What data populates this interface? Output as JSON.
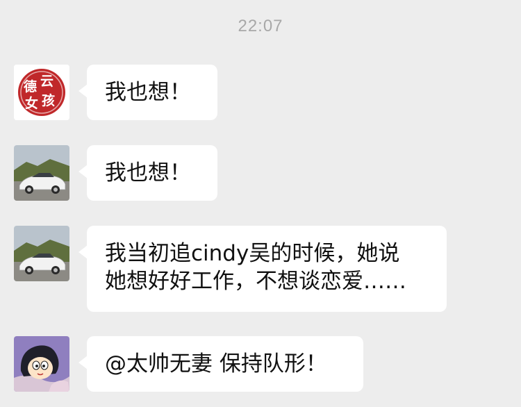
{
  "chat": {
    "timestamp": "22:07",
    "messages": [
      {
        "sender_avatar": "deyun-girl-stamp-avatar",
        "avatar_text": "德云女孩",
        "text": "我也想！"
      },
      {
        "sender_avatar": "white-sports-car-avatar",
        "text": "我也想！"
      },
      {
        "sender_avatar": "white-sports-car-avatar",
        "text": "我当初追cindy吴的时候，她说\n她想好好工作，不想谈恋爱……"
      },
      {
        "sender_avatar": "cartoon-girl-avatar",
        "text": "@太帅无妻  保持队形！"
      }
    ]
  },
  "colors": {
    "background": "#ededed",
    "bubble": "#ffffff",
    "stamp_red": "#c0282a",
    "timestamp": "#a8a8a8"
  }
}
